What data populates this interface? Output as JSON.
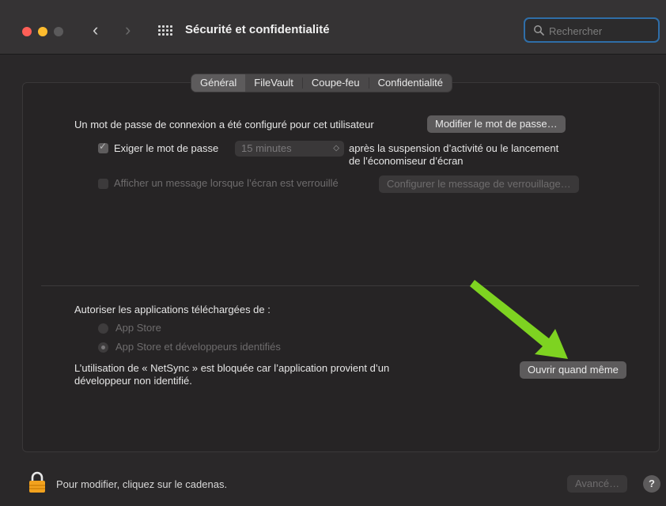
{
  "window": {
    "title": "Sécurité et confidentialité"
  },
  "search": {
    "placeholder": "Rechercher"
  },
  "tabs": [
    {
      "label": "Général",
      "active": true
    },
    {
      "label": "FileVault",
      "active": false
    },
    {
      "label": "Coupe-feu",
      "active": false
    },
    {
      "label": "Confidentialité",
      "active": false
    }
  ],
  "general": {
    "password_text": "Un mot de passe de connexion a été configuré pour cet utilisateur",
    "change_password_button": "Modifier le mot de passe…",
    "require_password_label": "Exiger le mot de passe",
    "require_password_checked": true,
    "delay_select_value": "15 minutes",
    "after_text_line1": "après la suspension d’activité ou le lancement",
    "after_text_line2": "de l’économiseur d’écran",
    "show_message_label": "Afficher un message lorsque l’écran est verrouillé",
    "show_message_checked": false,
    "configure_message_button": "Configurer le message de verrouillage…",
    "allow_apps_label": "Autoriser les applications téléchargées de :",
    "radio_options": [
      {
        "label": "App Store",
        "selected": false
      },
      {
        "label": "App Store et développeurs identifiés",
        "selected": true
      }
    ],
    "blocked_text_line1": "L’utilisation de « NetSync » est bloquée car l’application provient d’un",
    "blocked_text_line2": "développeur non identifié.",
    "open_anyway_button": "Ouvrir quand même"
  },
  "footer": {
    "lock_text": "Pour modifier, cliquez sur le cadenas.",
    "advanced_button": "Avancé…",
    "help_label": "?"
  },
  "colors": {
    "accent_search_border": "#2f6ea8",
    "arrow_green": "#7ed321",
    "lock_orange": "#f2a21e"
  }
}
